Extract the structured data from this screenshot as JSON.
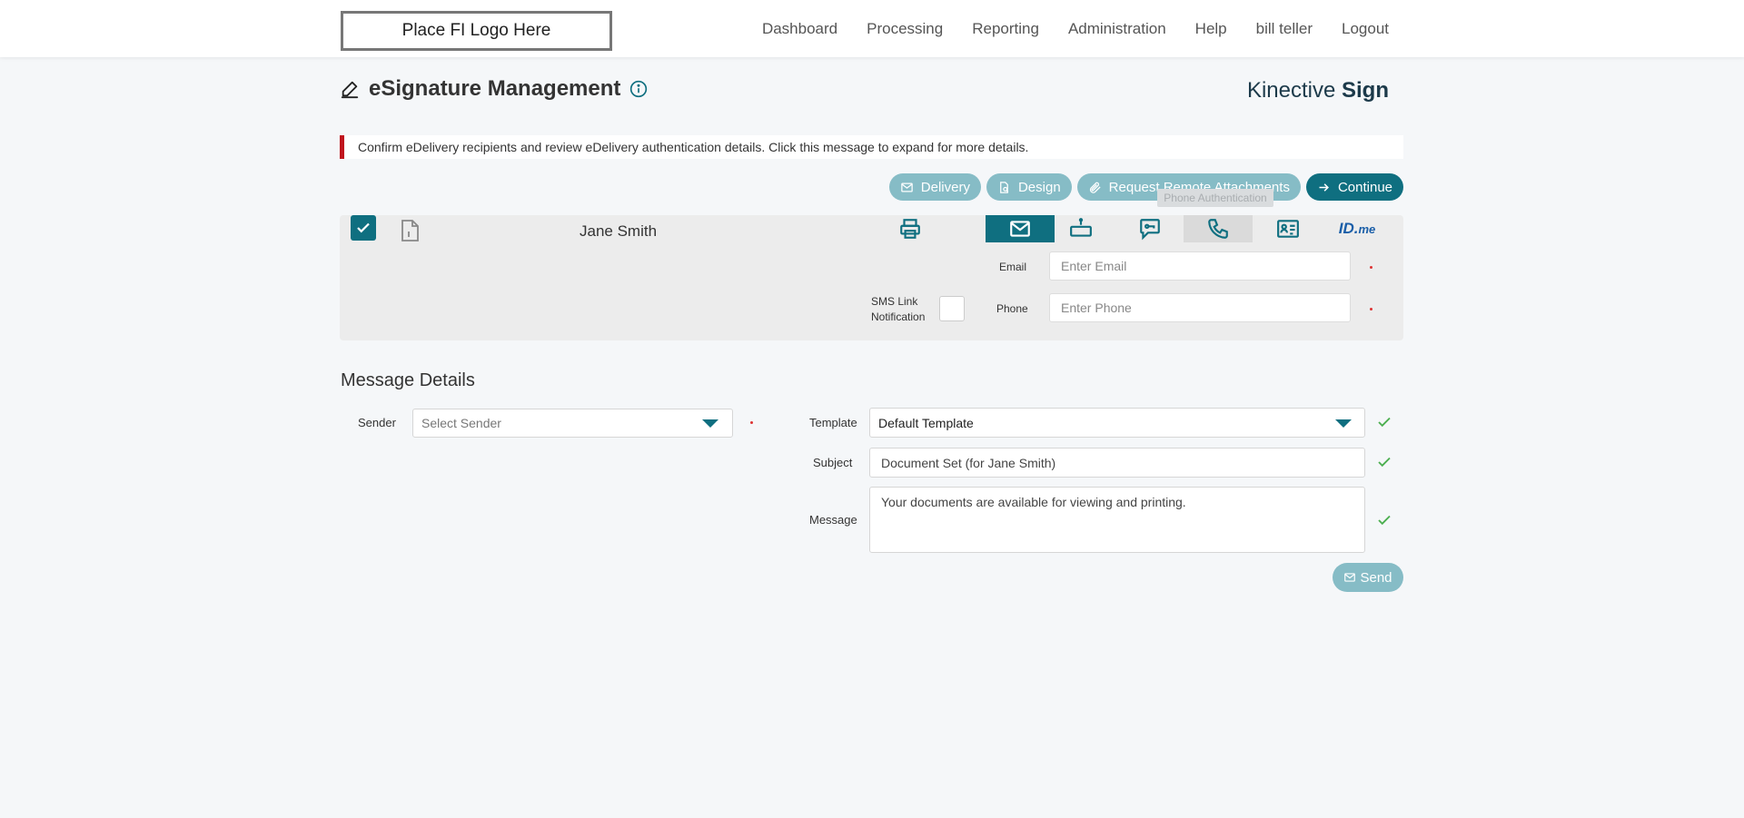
{
  "header": {
    "logo_text": "Place FI Logo Here",
    "nav": [
      "Dashboard",
      "Processing",
      "Reporting",
      "Administration",
      "Help",
      "bill teller",
      "Logout"
    ]
  },
  "page": {
    "title": "eSignature Management",
    "brand_regular": "Kinective ",
    "brand_bold": "Sign"
  },
  "alert": {
    "text": "Confirm eDelivery recipients and review eDelivery authentication details. Click this message to expand for more details.",
    "color": "#c0141d"
  },
  "actions": {
    "delivery": "Delivery",
    "design": "Design",
    "remote": "Request Remote Attachments",
    "continue": "Continue"
  },
  "tooltip": "Phone Authentication",
  "recipient": {
    "name": "Jane Smith",
    "selected": true,
    "idme_main": "ID.",
    "idme_sub": "me",
    "email_label": "Email",
    "email_placeholder": "Enter Email",
    "phone_label": "Phone",
    "phone_placeholder": "Enter Phone",
    "sms_label_1": "SMS Link",
    "sms_label_2": "Notification"
  },
  "message_details": {
    "title": "Message Details",
    "sender_label": "Sender",
    "sender_placeholder": "Select Sender",
    "template_label": "Template",
    "template_value": "Default Template",
    "subject_label": "Subject",
    "subject_value": "Document Set (for Jane Smith)",
    "message_label": "Message",
    "message_value": "Your documents are available for viewing and printing.",
    "send_label": "Send"
  },
  "colors": {
    "primary": "#0f6f80",
    "primary_light": "#86bcc6",
    "valid": "#4caf50"
  }
}
